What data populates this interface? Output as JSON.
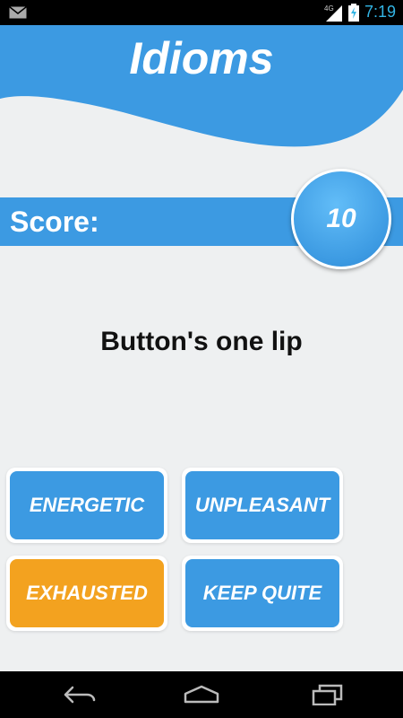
{
  "status_bar": {
    "time": "7:19",
    "network": "4G",
    "icons": [
      "mail-icon",
      "signal-icon",
      "battery-charging-icon"
    ]
  },
  "header": {
    "title": "Idioms"
  },
  "score": {
    "label": "Score:",
    "value": "10"
  },
  "question": {
    "text": "Button's one lip"
  },
  "answers": [
    {
      "label": "ENERGETIC",
      "selected": false
    },
    {
      "label": "UNPLEASANT",
      "selected": false
    },
    {
      "label": "EXHAUSTED",
      "selected": true
    },
    {
      "label": "KEEP QUITE",
      "selected": false
    }
  ],
  "nav_bar": {
    "icons": [
      "back-icon",
      "home-icon",
      "recents-icon"
    ]
  },
  "colors": {
    "primary_blue": "#3c9ae2",
    "selected_orange": "#f3a21f",
    "background": "#eef0f1",
    "status_time": "#33b5e5"
  }
}
